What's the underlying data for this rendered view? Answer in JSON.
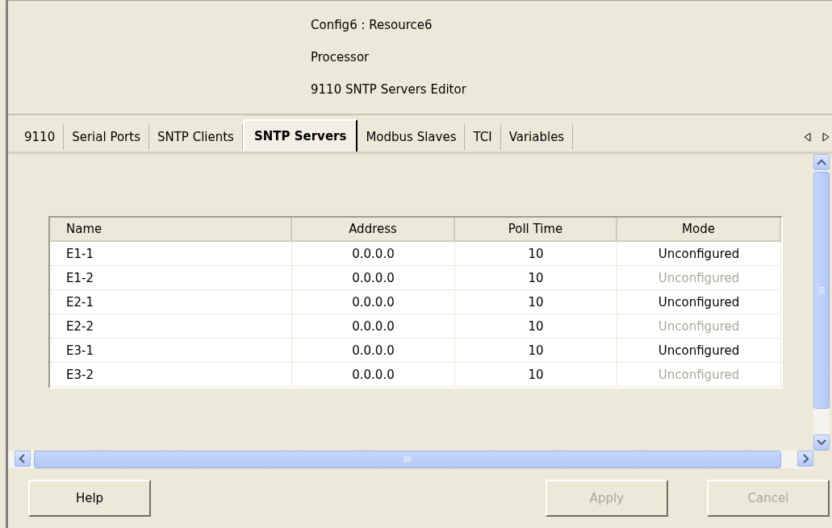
{
  "header": {
    "lines": [
      "Config6 : Resource6",
      "Processor",
      "9110 SNTP Servers Editor"
    ]
  },
  "tabs": [
    {
      "label": "9110",
      "selected": false
    },
    {
      "label": "Serial Ports",
      "selected": false
    },
    {
      "label": "SNTP Clients",
      "selected": false
    },
    {
      "label": "SNTP Servers",
      "selected": true
    },
    {
      "label": "Modbus Slaves",
      "selected": false
    },
    {
      "label": "TCI",
      "selected": false
    },
    {
      "label": "Variables",
      "selected": false
    }
  ],
  "table": {
    "columns": [
      "Name",
      "Address",
      "Poll Time",
      "Mode"
    ],
    "rows": [
      {
        "name": "E1-1",
        "address": "0.0.0.0",
        "poll_time": "10",
        "mode": "Unconfigured",
        "mode_disabled": false
      },
      {
        "name": "E1-2",
        "address": "0.0.0.0",
        "poll_time": "10",
        "mode": "Unconfigured",
        "mode_disabled": true
      },
      {
        "name": "E2-1",
        "address": "0.0.0.0",
        "poll_time": "10",
        "mode": "Unconfigured",
        "mode_disabled": false
      },
      {
        "name": "E2-2",
        "address": "0.0.0.0",
        "poll_time": "10",
        "mode": "Unconfigured",
        "mode_disabled": true
      },
      {
        "name": "E3-1",
        "address": "0.0.0.0",
        "poll_time": "10",
        "mode": "Unconfigured",
        "mode_disabled": false
      },
      {
        "name": "E3-2",
        "address": "0.0.0.0",
        "poll_time": "10",
        "mode": "Unconfigured",
        "mode_disabled": true
      }
    ]
  },
  "buttons": [
    {
      "label": "Help",
      "disabled": false
    },
    {
      "label": "Apply",
      "disabled": true
    },
    {
      "label": "Cancel",
      "disabled": true
    }
  ]
}
